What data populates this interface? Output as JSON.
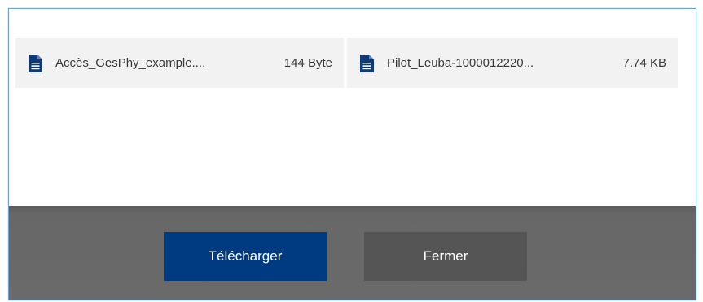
{
  "files": [
    {
      "name": "Accès_GesPhy_example....",
      "size": "144 Byte",
      "icon": "document-icon"
    },
    {
      "name": "Pilot_Leuba-1000012220...",
      "size": "7.74 KB",
      "icon": "document-icon"
    }
  ],
  "actions": {
    "download_label": "Télécharger",
    "close_label": "Fermer"
  },
  "colors": {
    "icon": "#0f3a7a",
    "download_button": "#003a80",
    "close_button": "#555555",
    "footer": "#676767",
    "file_item_background": "#f2f2f2",
    "border_accent": "#6fa0d8"
  }
}
